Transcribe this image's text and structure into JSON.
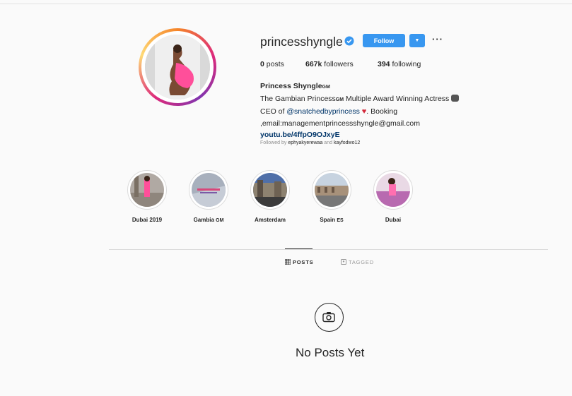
{
  "profile": {
    "username": "princesshyngle",
    "follow_label": "Follow",
    "dropdown_icon": "▼",
    "more_icon": "···",
    "stats": {
      "posts_count": "0",
      "posts_label": "posts",
      "followers_count": "667k",
      "followers_label": "followers",
      "following_count": "394",
      "following_label": "following"
    },
    "bio": {
      "name": "Princess Shyngle",
      "name_suffix": "GM",
      "line1_a": "The Gambian Princess",
      "line1_gm": "GM",
      "line1_b": " Multiple Award Winning Actress",
      "line2_a": "CEO of ",
      "line2_link": "@snatchedbyprincess",
      "line2_b": ". Booking",
      "line3": ",email:management​princessshyngle@gmail.com",
      "website": "youtu.be/4ffpO9OJxyE"
    },
    "followed_by_prefix": "Followed by",
    "followed_by_1": "ephyakyerewaa",
    "followed_by_and": "and",
    "followed_by_2": "kayfodwo12"
  },
  "highlights": [
    {
      "label": "Dubai 2019"
    },
    {
      "label": "Gambia",
      "suffix": "GM"
    },
    {
      "label": "Amsterdam"
    },
    {
      "label": "Spain",
      "suffix": "ES"
    },
    {
      "label": "Dubai"
    }
  ],
  "tabs": {
    "posts": "POSTS",
    "tagged": "TAGGED"
  },
  "empty_state": {
    "message": "No Posts Yet"
  },
  "colors": {
    "primary_button": "#3897f0",
    "link": "#003569",
    "background": "#fafafa"
  }
}
